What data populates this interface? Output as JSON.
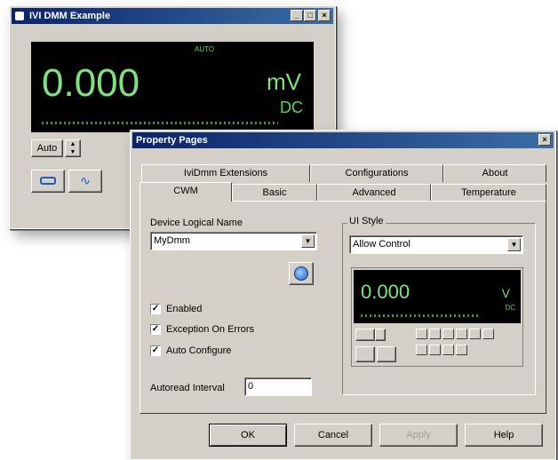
{
  "dmm_window": {
    "title": "IVI DMM Example",
    "range_mode_indicator": "AUTO",
    "reading": "0.000",
    "unit": "mV",
    "mode": "DC",
    "range_select": "Auto",
    "icons": [
      "continuous-read-icon",
      "waveform-icon"
    ]
  },
  "property_pages": {
    "title": "Property Pages",
    "tabs_row1": [
      "IviDmm Extensions",
      "Configurations",
      "About"
    ],
    "tabs_row2": [
      "CWM",
      "Basic",
      "Advanced",
      "Temperature"
    ],
    "active_tab": "CWM",
    "device_logical_name_label": "Device Logical Name",
    "device_logical_name_value": "MyDmm",
    "checkboxes": [
      {
        "label": "Enabled",
        "checked": true
      },
      {
        "label": "Exception On Errors",
        "checked": true
      },
      {
        "label": "Auto Configure",
        "checked": true
      }
    ],
    "autoread_label": "Autoread Interval",
    "autoread_value": "0",
    "ui_style_label": "UI Style",
    "ui_style_value": "Allow Control",
    "preview": {
      "reading": "0.000",
      "unit": "V",
      "mode": "DC"
    },
    "buttons": {
      "ok": "OK",
      "cancel": "Cancel",
      "apply": "Apply",
      "help": "Help"
    }
  }
}
